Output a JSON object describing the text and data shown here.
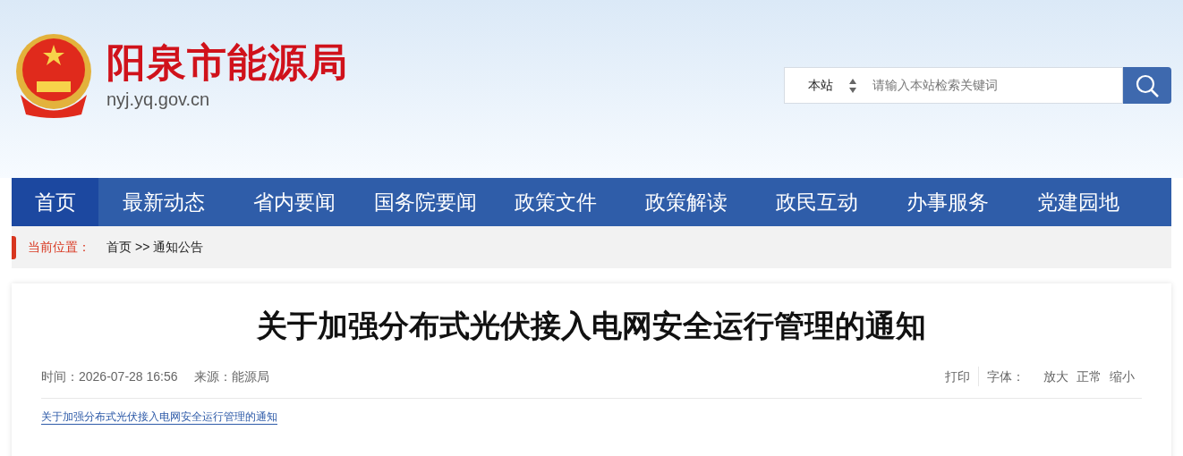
{
  "site": {
    "name": "阳泉市能源局",
    "domain": "nyj.yq.gov.cn"
  },
  "search": {
    "scope": "本站",
    "placeholder": "请输入本站检索关键词"
  },
  "nav": [
    {
      "label": "首页",
      "selected": true
    },
    {
      "label": "最新动态",
      "selected": false
    },
    {
      "label": "省内要闻",
      "selected": false
    },
    {
      "label": "国务院要闻",
      "selected": false
    },
    {
      "label": "政策文件",
      "selected": false
    },
    {
      "label": "政策解读",
      "selected": false
    },
    {
      "label": "政民互动",
      "selected": false
    },
    {
      "label": "办事服务",
      "selected": false
    },
    {
      "label": "党建园地",
      "selected": false
    }
  ],
  "breadcrumb": {
    "label": "当前位置：",
    "items": [
      "首页",
      "通知公告"
    ],
    "separator": ">>"
  },
  "article": {
    "title": "关于加强分布式光伏接入电网安全运行管理的通知",
    "time": "时间：2026-07-28 16:56",
    "source": "来源：能源局",
    "print": "打印",
    "font_label": "字体：",
    "font_sizes": [
      "放大",
      "正常",
      "缩小"
    ],
    "attachment": "关于加强分布式光伏接入电网安全运行管理的通知"
  }
}
